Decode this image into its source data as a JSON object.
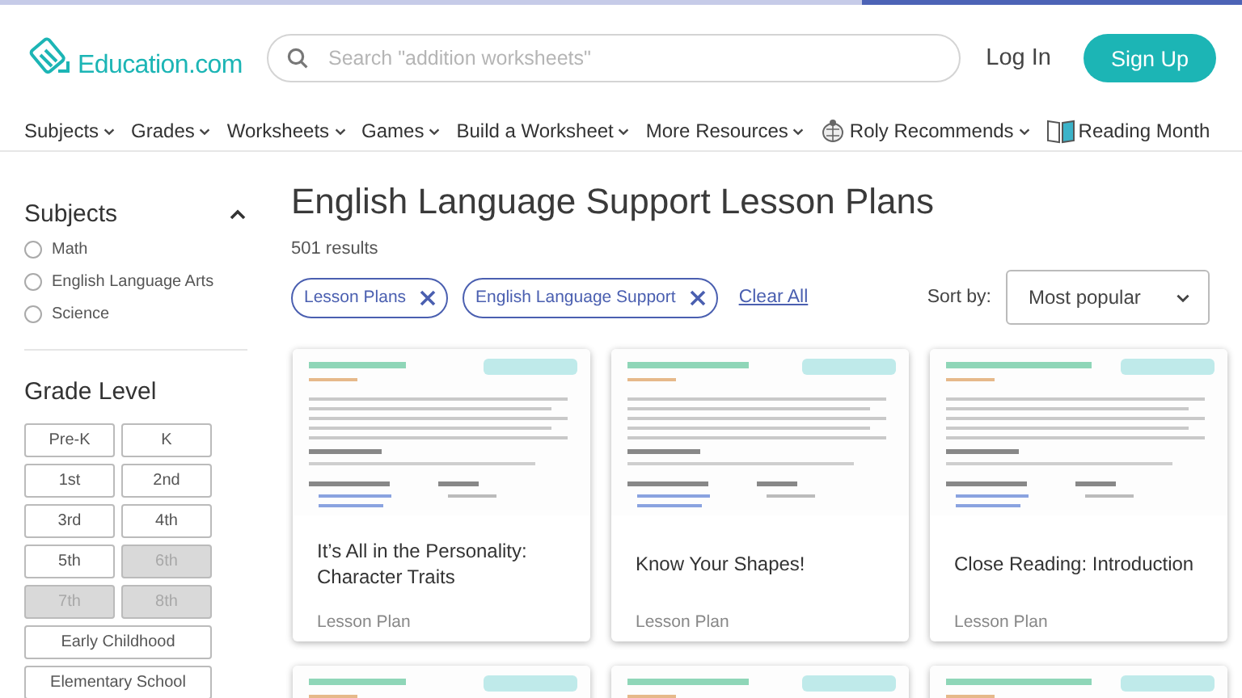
{
  "header": {
    "logo": "Education.com",
    "search": {
      "placeholder": "Search \"addition worksheets\""
    },
    "login": "Log In",
    "signup": "Sign Up"
  },
  "nav": [
    {
      "label": "Subjects",
      "kind": "menu"
    },
    {
      "label": "Grades",
      "kind": "menu"
    },
    {
      "label": "Worksheets",
      "kind": "menu"
    },
    {
      "label": "Games",
      "kind": "menu"
    },
    {
      "label": "Build a Worksheet",
      "kind": "menu"
    },
    {
      "label": "More Resources",
      "kind": "menu"
    },
    {
      "label": "Roly Recommends",
      "kind": "bug-menu"
    },
    {
      "label": "Reading Month",
      "kind": "book-link"
    }
  ],
  "sidebar": {
    "subjects": {
      "title": "Subjects",
      "expanded": true,
      "options": [
        {
          "label": "Math",
          "checked": false
        },
        {
          "label": "English Language Arts",
          "checked": false
        },
        {
          "label": "Science",
          "checked": false
        }
      ]
    },
    "grade_level": {
      "title": "Grade Level",
      "grades": [
        {
          "label": "Pre-K",
          "kind": "half",
          "disabled": false
        },
        {
          "label": "K",
          "kind": "half",
          "disabled": false
        },
        {
          "label": "1st",
          "kind": "half",
          "disabled": false
        },
        {
          "label": "2nd",
          "kind": "half",
          "disabled": false
        },
        {
          "label": "3rd",
          "kind": "half",
          "disabled": false
        },
        {
          "label": "4th",
          "kind": "half",
          "disabled": false
        },
        {
          "label": "5th",
          "kind": "half",
          "disabled": false
        },
        {
          "label": "6th",
          "kind": "half",
          "disabled": true
        },
        {
          "label": "7th",
          "kind": "half",
          "disabled": true
        },
        {
          "label": "8th",
          "kind": "half",
          "disabled": true
        },
        {
          "label": "Early Childhood",
          "kind": "wide",
          "disabled": false
        },
        {
          "label": "Elementary School",
          "kind": "wide",
          "disabled": false
        }
      ]
    }
  },
  "main": {
    "title": "English Language Support Lesson Plans",
    "count": "501 results",
    "filters": [
      {
        "label": "Lesson Plans"
      },
      {
        "label": "English Language Support"
      }
    ],
    "clear_all": "Clear All",
    "sort": {
      "label": "Sort by:",
      "value": "Most popular"
    },
    "cards": [
      {
        "kind": "lesson",
        "title": "It’s All in the Personality: Character Traits",
        "type": "Lesson Plan"
      },
      {
        "kind": "lesson",
        "title": "Know Your Shapes!",
        "type": "Lesson Plan"
      },
      {
        "kind": "lesson",
        "title": "Close Reading: Introduction",
        "type": "Lesson Plan"
      },
      {
        "kind": "picture"
      },
      {
        "kind": "picture"
      },
      {
        "kind": "picture"
      }
    ]
  }
}
